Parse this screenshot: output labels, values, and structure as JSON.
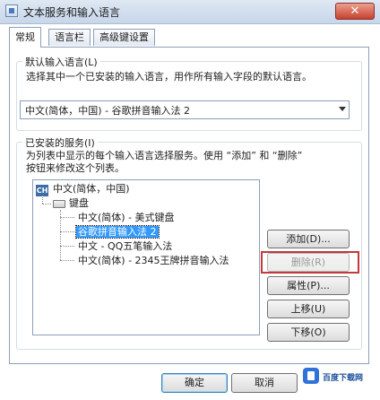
{
  "window": {
    "title": "文本服务和输入语言",
    "close_label": "✕"
  },
  "tabs": [
    {
      "label": "常规",
      "active": true
    },
    {
      "label": "语言栏",
      "active": false
    },
    {
      "label": "高级键设置",
      "active": false
    }
  ],
  "default_language": {
    "legend": "默认输入语言(L)",
    "description": "选择其中一个已安装的输入语言，用作所有输入字段的默认语言。",
    "selected": "中文(简体，中国) - 谷歌拼音输入法 2"
  },
  "installed_services": {
    "legend": "已安装的服务(I)",
    "description_line1": "为列表中显示的每个输入语言选择服务。使用 “添加” 和 “删除”",
    "description_line2": "按钮来修改这个列表。",
    "tree": {
      "language": "中文(简体，中国)",
      "language_icon": "CH",
      "category": "键盘",
      "items": [
        {
          "label": "中文(简体) - 美式键盘",
          "selected": false
        },
        {
          "label": "谷歌拼音输入法 2",
          "selected": true
        },
        {
          "label": "中文 - QQ五笔输入法",
          "selected": false
        },
        {
          "label": "中文(简体) - 2345王牌拼音输入法",
          "selected": false
        }
      ]
    },
    "buttons": {
      "add": "添加(D)...",
      "remove": "删除(R)",
      "properties": "属性(P)...",
      "move_up": "上移(U)",
      "move_down": "下移(O)"
    }
  },
  "footer": {
    "ok": "确定",
    "cancel": "取消"
  },
  "watermark": {
    "text": "百度下载网"
  },
  "colors": {
    "highlight": "#3399ff",
    "annotation_box": "#c23a3a"
  }
}
